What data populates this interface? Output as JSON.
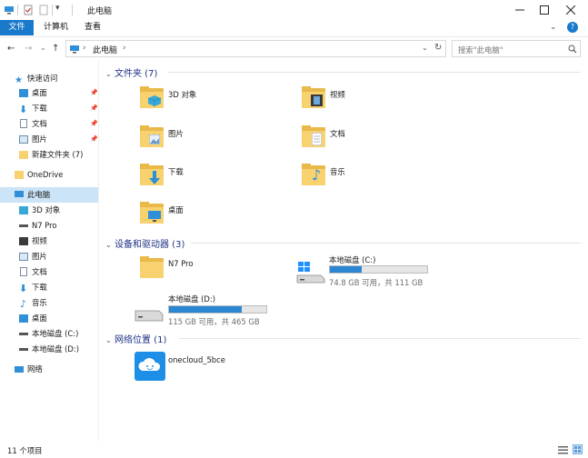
{
  "window": {
    "title": "此电脑"
  },
  "ribbon": {
    "tabs": [
      {
        "label": "文件"
      },
      {
        "label": "计算机"
      },
      {
        "label": "查看"
      }
    ]
  },
  "address": {
    "crumb": "此电脑",
    "sep_left": "›",
    "sep_right": "›"
  },
  "search": {
    "placeholder": "搜索\"此电脑\""
  },
  "sidebar": {
    "quick_access": "快速访问",
    "quick_items": [
      {
        "label": "桌面",
        "pinned": true
      },
      {
        "label": "下载",
        "pinned": true
      },
      {
        "label": "文档",
        "pinned": true
      },
      {
        "label": "图片",
        "pinned": true
      },
      {
        "label": "新建文件夹 (7)",
        "pinned": false
      }
    ],
    "onedrive": "OneDrive",
    "this_pc": "此电脑",
    "pc_items": [
      {
        "label": "3D 对象"
      },
      {
        "label": "N7 Pro"
      },
      {
        "label": "视频"
      },
      {
        "label": "图片"
      },
      {
        "label": "文档"
      },
      {
        "label": "下载"
      },
      {
        "label": "音乐"
      },
      {
        "label": "桌面"
      },
      {
        "label": "本地磁盘 (C:)"
      },
      {
        "label": "本地磁盘 (D:)"
      }
    ],
    "network": "网络"
  },
  "main": {
    "folders_header": "文件夹 (7)",
    "folders": [
      {
        "label": "3D 对象"
      },
      {
        "label": "视频"
      },
      {
        "label": "图片"
      },
      {
        "label": "文档"
      },
      {
        "label": "下载"
      },
      {
        "label": "音乐"
      },
      {
        "label": "桌面"
      }
    ],
    "devices_header": "设备和驱动器 (3)",
    "devices": {
      "n7": {
        "label": "N7 Pro"
      },
      "c": {
        "label": "本地磁盘 (C:)",
        "free": "74.8 GB 可用，共 111 GB",
        "used_fraction": 0.33
      },
      "d": {
        "label": "本地磁盘 (D:)",
        "free": "115 GB 可用，共 465 GB",
        "used_fraction": 0.75
      }
    },
    "network_header": "网络位置 (1)",
    "network_items": [
      {
        "label": "onecloud_5bce"
      }
    ]
  },
  "status": {
    "count": "11 个项目"
  },
  "colors": {
    "accent": "#1979ca",
    "folder": "#f7d26f",
    "folder_back": "#e9b94a",
    "header": "#1e3287",
    "drive_bar": "#2b87d1"
  }
}
